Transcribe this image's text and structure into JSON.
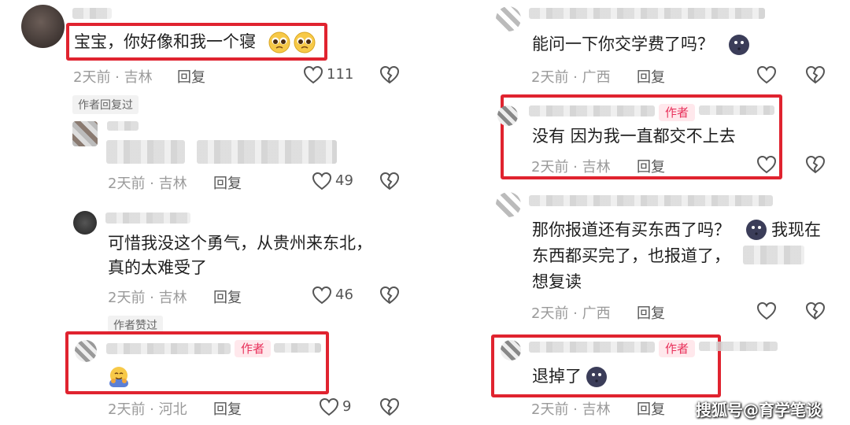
{
  "left": {
    "c1": {
      "text": "宝宝，你好像和我一个寝",
      "meta": "2天前 · 吉林",
      "reply": "回复",
      "likes": "111"
    },
    "author_replied": "作者回复过",
    "c2": {
      "meta": "2天前 · 吉林",
      "reply": "回复",
      "likes": "49"
    },
    "c3": {
      "line1": "可惜我没这个勇气，从贵州来东北，",
      "line2": "真的太难受了",
      "meta": "2天前 · 吉林",
      "reply": "回复",
      "likes": "46"
    },
    "author_liked": "作者赞过",
    "c4": {
      "tag": "作者",
      "meta": "2天前 · 河北",
      "reply": "回复",
      "likes": "9"
    }
  },
  "right": {
    "c1": {
      "text": "能问一下你交学费了吗？",
      "meta": "2天前 · 广西",
      "reply": "回复"
    },
    "c2": {
      "tag": "作者",
      "text": "没有 因为我一直都交不上去",
      "meta": "2天前 · 吉林",
      "reply": "回复"
    },
    "c3": {
      "line1": "那你报道还有买东西了吗？",
      "line1b": "我现在",
      "line2": "东西都买完了，也报道了，",
      "line3": "想复读",
      "meta": "2天前 · 广西",
      "reply": "回复"
    },
    "c4": {
      "tag": "作者",
      "text": "退掉了",
      "meta": "2天前 · 吉林",
      "reply": "回复"
    }
  },
  "watermark": "搜狐号@育学笔谈",
  "colors": {
    "highlight": "#e0232f",
    "author_tag": "#e8315b",
    "meta": "#9a9a9a"
  }
}
